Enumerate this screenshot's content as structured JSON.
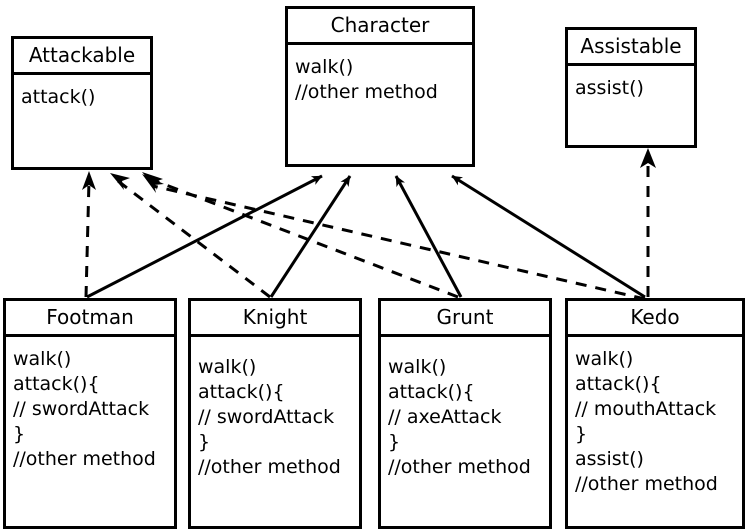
{
  "diagram": {
    "kind": "uml-class-diagram",
    "stroke_color": "#000000",
    "background_color": "#ffffff"
  },
  "interfaces": [
    {
      "id": "attackable",
      "name": "Attackable",
      "members": [
        "attack()"
      ]
    },
    {
      "id": "assistable",
      "name": "Assistable",
      "members": [
        "assist()"
      ]
    }
  ],
  "base_class": {
    "id": "character",
    "name": "Character",
    "members": [
      "walk()",
      "//other method"
    ]
  },
  "subclasses": [
    {
      "id": "footman",
      "name": "Footman",
      "members": [
        "walk()",
        "attack(){",
        "// swordAttack",
        "}",
        "//other method"
      ]
    },
    {
      "id": "knight",
      "name": "Knight",
      "members": [
        "walk()",
        "attack(){",
        "// swordAttack",
        "}",
        "//other method"
      ]
    },
    {
      "id": "grunt",
      "name": "Grunt",
      "members": [
        "walk()",
        "attack(){",
        "// axeAttack",
        "}",
        "//other method"
      ]
    },
    {
      "id": "kedo",
      "name": "Kedo",
      "members": [
        "walk()",
        "attack(){",
        "// mouthAttack",
        "}",
        "assist()",
        "//other method"
      ]
    }
  ],
  "relations": {
    "generalizations": [
      {
        "from": "footman",
        "to": "character",
        "style": "solid"
      },
      {
        "from": "knight",
        "to": "character",
        "style": "solid"
      },
      {
        "from": "grunt",
        "to": "character",
        "style": "solid"
      },
      {
        "from": "kedo",
        "to": "character",
        "style": "solid"
      }
    ],
    "realizations": [
      {
        "from": "footman",
        "to": "attackable",
        "style": "dashed"
      },
      {
        "from": "knight",
        "to": "attackable",
        "style": "dashed"
      },
      {
        "from": "grunt",
        "to": "attackable",
        "style": "dashed"
      },
      {
        "from": "kedo",
        "to": "attackable",
        "style": "dashed"
      },
      {
        "from": "kedo",
        "to": "assistable",
        "style": "dashed"
      }
    ]
  }
}
